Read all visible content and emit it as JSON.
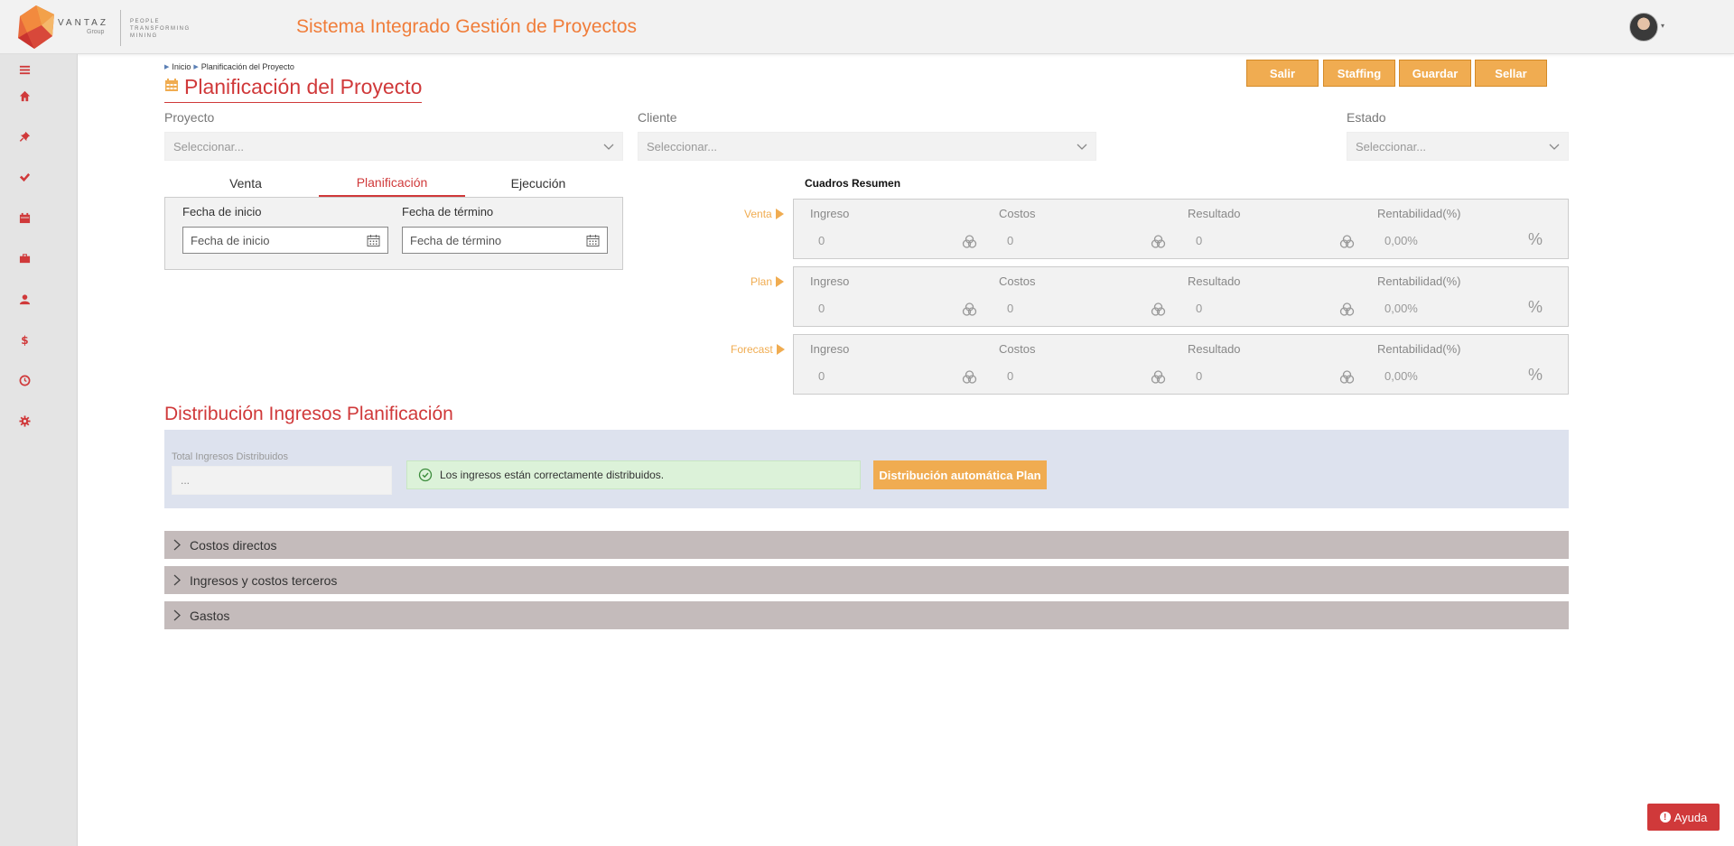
{
  "header": {
    "brand": "VANTAZ",
    "brand_sub": "Group",
    "tagline_1": "PEOPLE",
    "tagline_2": "TRANSFORMING",
    "tagline_3": "MINING",
    "app_title": "Sistema Integrado Gestión de Proyectos"
  },
  "sidebar": {
    "items": [
      "menu-icon",
      "home-icon",
      "pin-icon",
      "check-icon",
      "calendar-icon",
      "briefcase-icon",
      "user-icon",
      "dollar-icon",
      "clock-icon",
      "gear-icon"
    ]
  },
  "breadcrumb": {
    "home": "Inicio",
    "current": "Planificación del Proyecto"
  },
  "page_title": "Planificación del Proyecto",
  "actions": {
    "salir": "Salir",
    "staffing": "Staffing",
    "guardar": "Guardar",
    "sellar": "Sellar"
  },
  "filters": {
    "proyecto_label": "Proyecto",
    "proyecto_value": "Seleccionar...",
    "cliente_label": "Cliente",
    "cliente_value": "Seleccionar...",
    "estado_label": "Estado",
    "estado_value": "Seleccionar..."
  },
  "tabs": {
    "venta": "Venta",
    "planificacion": "Planificación",
    "ejecucion": "Ejecución",
    "active": "Planificación"
  },
  "dates": {
    "inicio_label": "Fecha de inicio",
    "inicio_placeholder": "Fecha de inicio",
    "termino_label": "Fecha de término",
    "termino_placeholder": "Fecha de término"
  },
  "summary": {
    "title": "Cuadros Resumen",
    "col_ingreso": "Ingreso",
    "col_costos": "Costos",
    "col_resultado": "Resultado",
    "col_rentabilidad": "Rentabilidad(%)",
    "percent_symbol": "%",
    "rows": [
      {
        "label": "Venta",
        "ingreso": "0",
        "costos": "0",
        "resultado": "0",
        "rentabilidad": "0,00%"
      },
      {
        "label": "Plan",
        "ingreso": "0",
        "costos": "0",
        "resultado": "0",
        "rentabilidad": "0,00%"
      },
      {
        "label": "Forecast",
        "ingreso": "0",
        "costos": "0",
        "resultado": "0",
        "rentabilidad": "0,00%"
      }
    ]
  },
  "distribution": {
    "title": "Distribución Ingresos Planificación",
    "total_label": "Total Ingresos Distribuidos",
    "total_value": "...",
    "alert": "Los ingresos están correctamente distribuidos.",
    "auto_button": "Distribución automática Plan"
  },
  "accordions": [
    "Costos directos",
    "Ingresos y costos terceros",
    "Gastos"
  ],
  "help_button": "Ayuda",
  "colors": {
    "primary_red": "#d0393a",
    "accent_orange": "#f0ac51",
    "title_orange": "#f07d3a"
  }
}
